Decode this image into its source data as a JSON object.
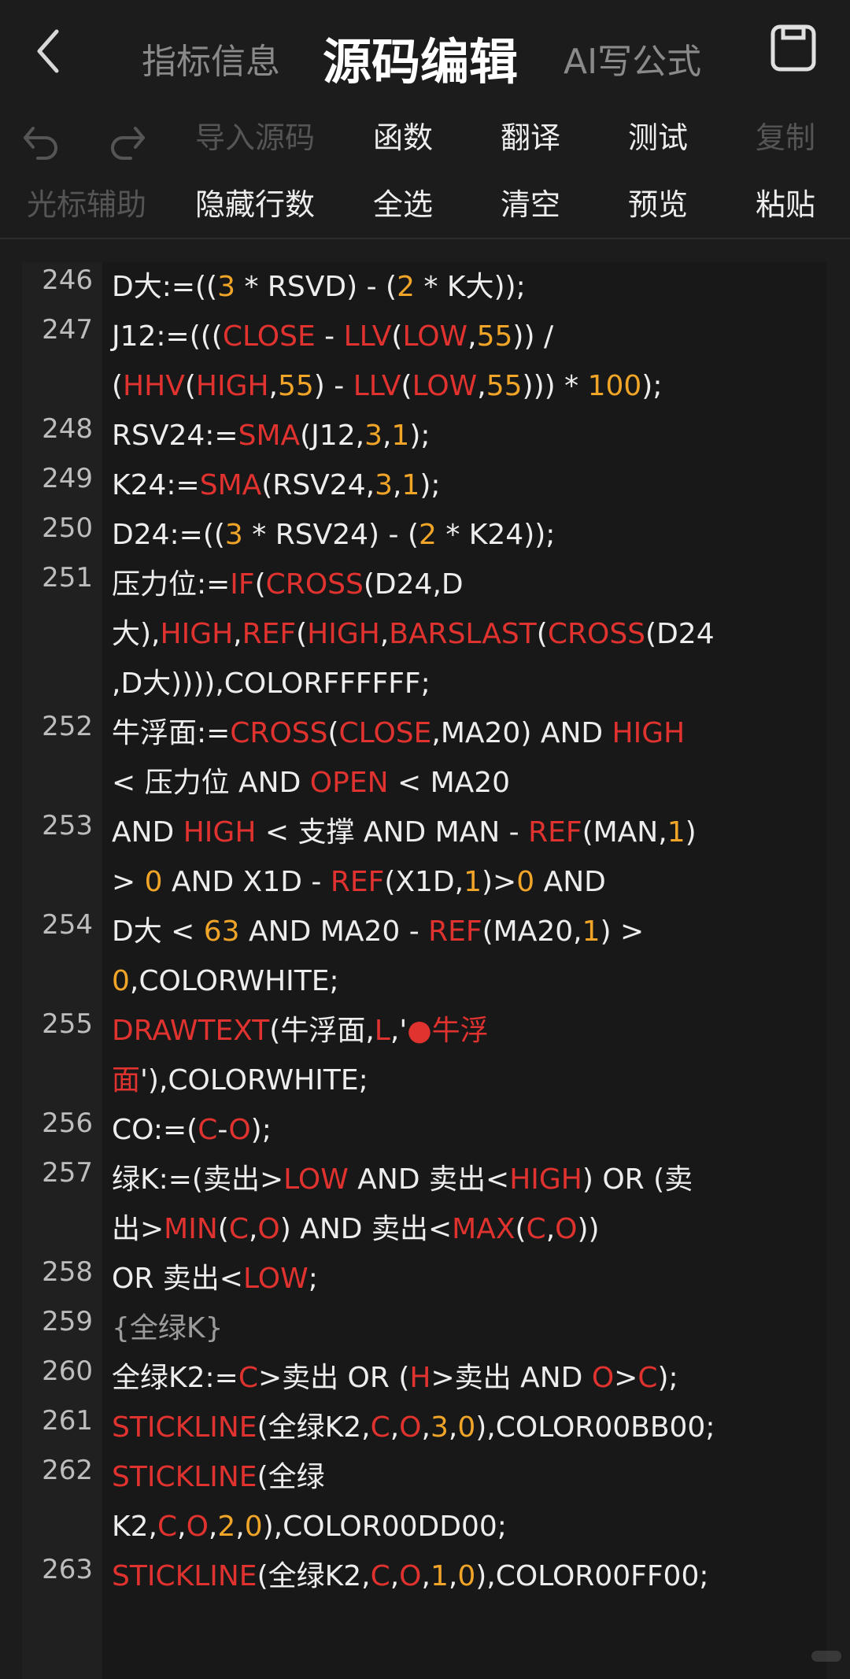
{
  "header": {
    "tabs": [
      "指标信息",
      "源码编辑",
      "AI写公式"
    ],
    "active_tab": "源码编辑"
  },
  "toolbar": {
    "row1": [
      {
        "label": "导入源码",
        "enabled": false
      },
      {
        "label": "函数",
        "enabled": true
      },
      {
        "label": "翻译",
        "enabled": true
      },
      {
        "label": "测试",
        "enabled": true
      },
      {
        "label": "复制",
        "enabled": false
      }
    ],
    "row2": [
      {
        "label": "光标辅助",
        "enabled": false
      },
      {
        "label": "隐藏行数",
        "enabled": true
      },
      {
        "label": "全选",
        "enabled": true
      },
      {
        "label": "清空",
        "enabled": true
      },
      {
        "label": "预览",
        "enabled": true
      },
      {
        "label": "粘贴",
        "enabled": true
      }
    ]
  },
  "editor": {
    "lines": [
      {
        "number": "246",
        "rows": [
          "D大:=((3 * RSVD) - (2 * K大));"
        ]
      },
      {
        "number": "247",
        "rows": [
          "J12:=(((CLOSE - LLV(LOW,55)) /",
          "(HHV(HIGH,55) - LLV(LOW,55))) * 100);"
        ]
      },
      {
        "number": "248",
        "rows": [
          "RSV24:=SMA(J12,3,1);"
        ]
      },
      {
        "number": "249",
        "rows": [
          "K24:=SMA(RSV24,3,1);"
        ]
      },
      {
        "number": "250",
        "rows": [
          "D24:=((3 * RSV24) - (2 * K24));"
        ]
      },
      {
        "number": "251",
        "rows": [
          "压力位:=IF(CROSS(D24,D",
          "大),HIGH,REF(HIGH,BARSLAST(CROSS(D24",
          ",D大)))),COLORFFFFFF;"
        ]
      },
      {
        "number": "252",
        "rows": [
          "牛浮面:=CROSS(CLOSE,MA20) AND HIGH",
          "< 压力位 AND OPEN < MA20"
        ]
      },
      {
        "number": "253",
        "rows": [
          "AND HIGH < 支撑 AND MAN - REF(MAN,1)",
          "> 0 AND X1D - REF(X1D,1)>0 AND"
        ]
      },
      {
        "number": "254",
        "rows": [
          "D大 < 63 AND MA20 - REF(MA20,1) >",
          "0,COLORWHITE;"
        ]
      },
      {
        "number": "255",
        "rows": [
          "DRAWTEXT(牛浮面,L,'●牛浮",
          "面'),COLORWHITE;"
        ]
      },
      {
        "number": "256",
        "rows": [
          "CO:=(C-O);"
        ]
      },
      {
        "number": "257",
        "rows": [
          "绿K:=(卖出>LOW AND 卖出<HIGH) OR (卖",
          "出>MIN(C,O) AND 卖出<MAX(C,O))"
        ]
      },
      {
        "number": "258",
        "rows": [
          "OR 卖出<LOW;"
        ]
      },
      {
        "number": "259",
        "rows": [
          "{全绿K}"
        ]
      },
      {
        "number": "260",
        "rows": [
          "全绿K2:=C>卖出 OR (H>卖出 AND O>C);"
        ]
      },
      {
        "number": "261",
        "rows": [
          "STICKLINE(全绿K2,C,O,3,0),COLOR00BB00;"
        ]
      },
      {
        "number": "262",
        "rows": [
          "STICKLINE(全绿",
          "K2,C,O,2,0),COLOR00DD00;"
        ]
      },
      {
        "number": "263",
        "rows": [
          "STICKLINE(全绿K2,C,O,1,0),COLOR00FF00;"
        ]
      }
    ]
  },
  "colors": {
    "keyword": "#e0322f",
    "number": "#f0a528",
    "comment": "#9b9b9b",
    "text": "#ededed",
    "background": "#1c1c1c"
  },
  "icons": {
    "back": "chevron-left-icon",
    "save": "save-icon",
    "undo": "undo-icon",
    "redo": "redo-icon"
  }
}
